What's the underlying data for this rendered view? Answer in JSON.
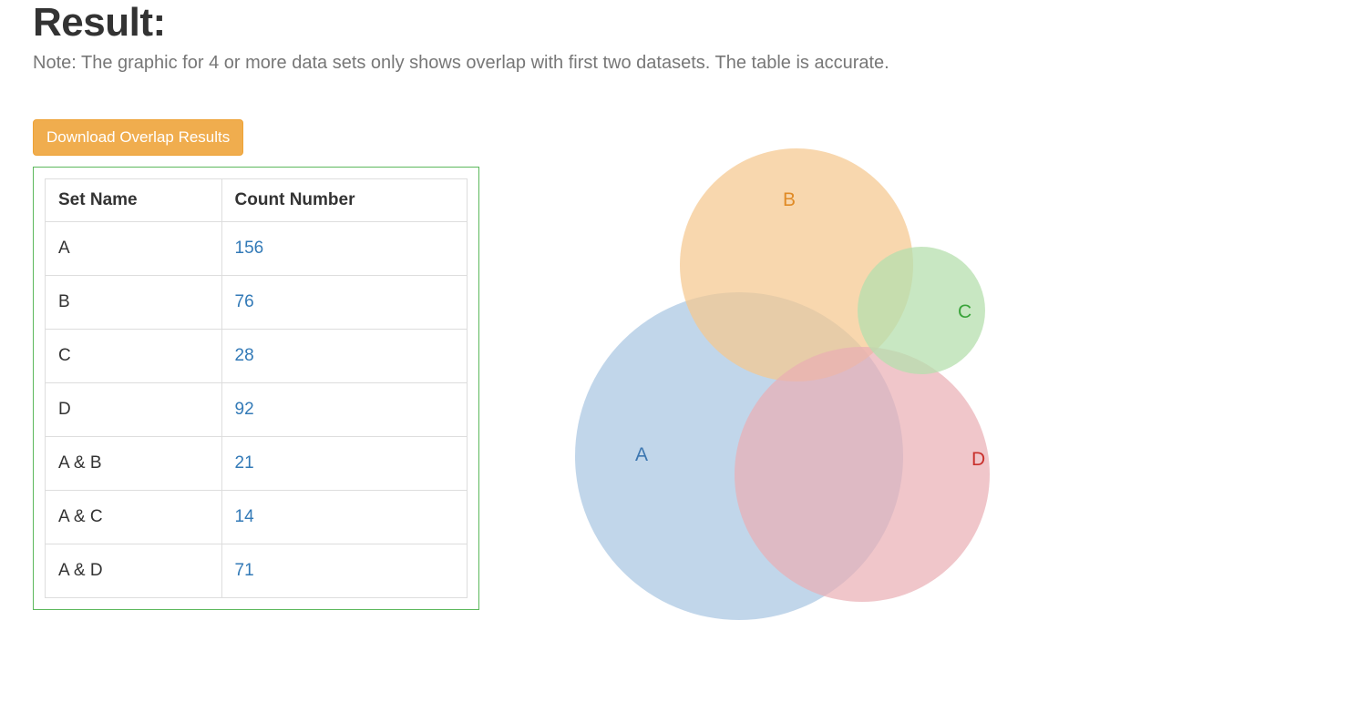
{
  "header": {
    "title": "Result:",
    "note": "Note: The graphic for 4 or more data sets only shows overlap with first two datasets. The table is accurate."
  },
  "buttons": {
    "download_label": "Download Overlap Results"
  },
  "table": {
    "headers": {
      "set": "Set Name",
      "count": "Count Number"
    },
    "rows": [
      {
        "set": "A",
        "count": "156"
      },
      {
        "set": "B",
        "count": "76"
      },
      {
        "set": "C",
        "count": "28"
      },
      {
        "set": "D",
        "count": "92"
      },
      {
        "set": "A & B",
        "count": "21"
      },
      {
        "set": "A & C",
        "count": "14"
      },
      {
        "set": "A & D",
        "count": "71"
      }
    ]
  },
  "venn": {
    "labels": {
      "A": "A",
      "B": "B",
      "C": "C",
      "D": "D"
    },
    "colors": {
      "A_fill": "#a9c6e2",
      "A_label": "#3c76b0",
      "B_fill": "#f5c78f",
      "B_label": "#e08b27",
      "C_fill": "#b6dfae",
      "C_label": "#3aa43a",
      "D_fill": "#e9aeb3",
      "D_label": "#c9302c"
    }
  },
  "chart_data": {
    "type": "venn",
    "sets": [
      {
        "name": "A",
        "size": 156
      },
      {
        "name": "B",
        "size": 76
      },
      {
        "name": "C",
        "size": 28
      },
      {
        "name": "D",
        "size": 92
      }
    ],
    "overlaps": [
      {
        "sets": [
          "A",
          "B"
        ],
        "size": 21
      },
      {
        "sets": [
          "A",
          "C"
        ],
        "size": 14
      },
      {
        "sets": [
          "A",
          "D"
        ],
        "size": 71
      }
    ],
    "note": "Graphic for 4+ sets only shows overlap with first two datasets; table is accurate."
  }
}
